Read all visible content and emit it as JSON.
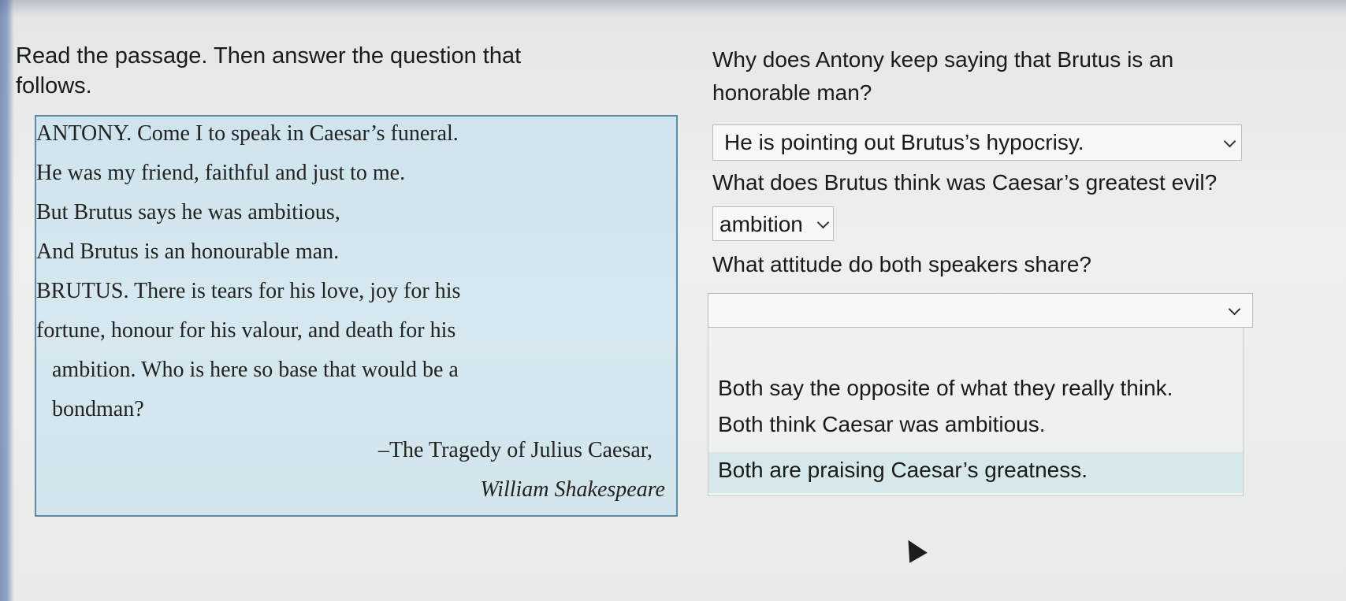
{
  "instructions": {
    "line1": "Read the passage. Then answer the question that",
    "line2": "follows."
  },
  "passage": {
    "lines": [
      "ANTONY. Come I to speak in Caesar’s funeral.",
      "He was my friend, faithful and just to me.",
      "But Brutus says he was ambitious,",
      "And Brutus is an honourable man.",
      "BRUTUS. There is tears for his love, joy for his",
      "fortune, honour for his valour, and death for his",
      "ambition. Who is here so base that would be a",
      "bondman?"
    ],
    "citation_title": "–The Tragedy of Julius Caesar,",
    "citation_author": "William Shakespeare"
  },
  "questions": [
    {
      "text_line1": "Why does Antony keep saying that Brutus is an",
      "text_line2": "honorable man?",
      "selected": "He is pointing out Brutus’s hypocrisy."
    },
    {
      "text_line1": "What does Brutus think was Caesar’s greatest evil?",
      "selected": "ambition"
    },
    {
      "text_line1": "What attitude do both speakers share?",
      "selected": "",
      "options": [
        "Both say the opposite of what they really think.",
        "Both think Caesar was ambitious.",
        "Both are praising Caesar’s greatness."
      ]
    }
  ]
}
